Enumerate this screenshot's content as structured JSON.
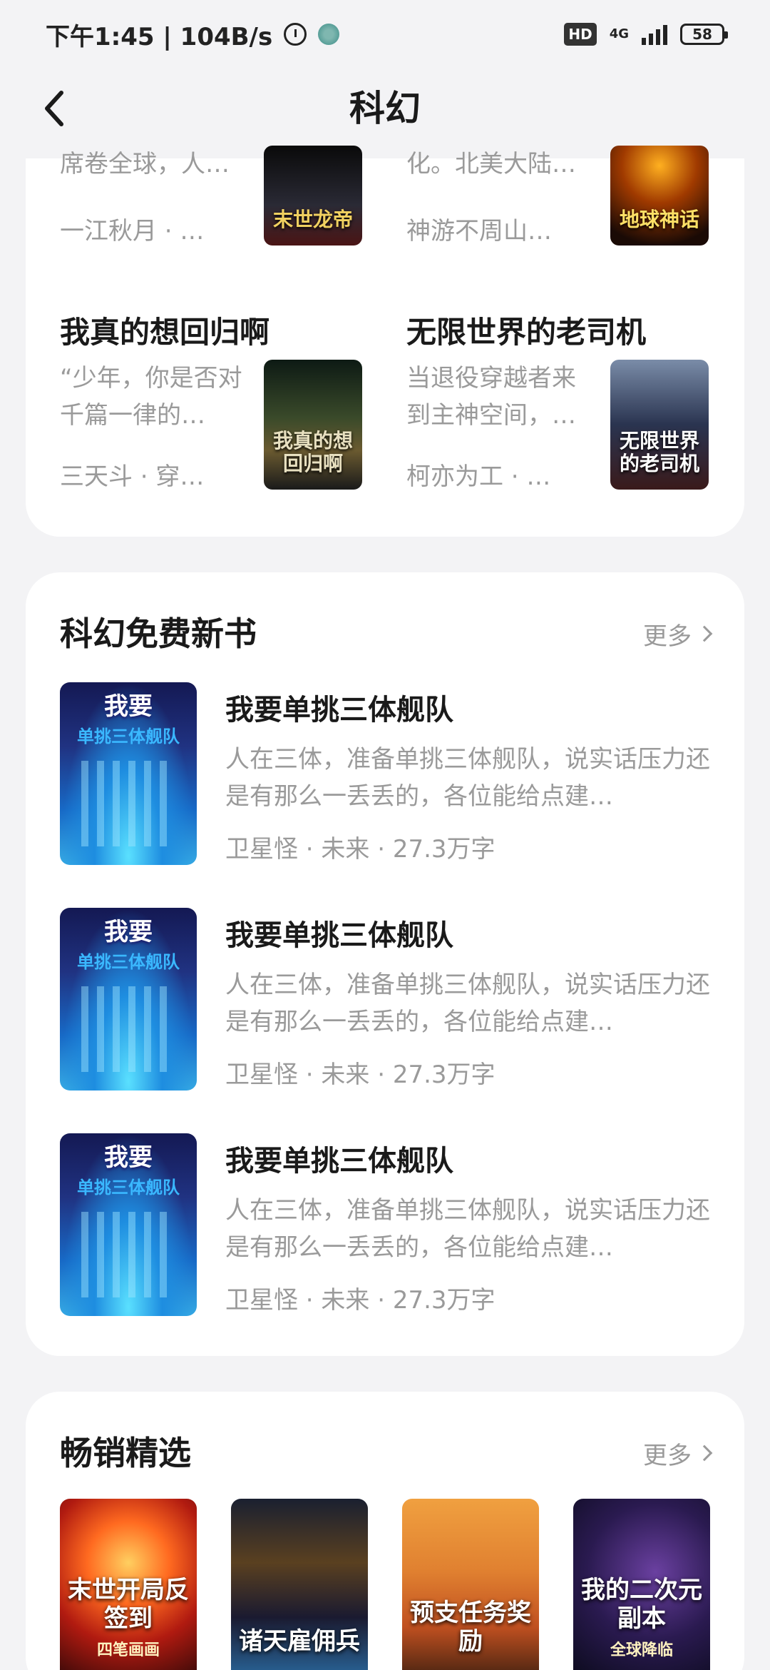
{
  "status_bar": {
    "time_speed": "下午1:45 | 104B/s",
    "hd": "HD",
    "network": "4G",
    "battery": "58"
  },
  "header": {
    "title": "科幻"
  },
  "grid": {
    "row1": [
      {
        "intro": "席卷全球，人…",
        "author": "一江秋月 · …",
        "cover_text": "末世龙帝"
      },
      {
        "intro": "化。北美大陆…",
        "author": "神游不周山…",
        "cover_text": "地球神话"
      }
    ],
    "row2": [
      {
        "title": "我真的想回归啊",
        "intro": "“少年，你是否对千篇一律的…",
        "author": "三天斗 · 穿…",
        "cover_text": "我真的想回归啊"
      },
      {
        "title": "无限世界的老司机",
        "intro": "当退役穿越者来到主神空间，…",
        "author": "柯亦为工 · …",
        "cover_text": "无限世界的老司机"
      }
    ]
  },
  "free_new": {
    "title": "科幻免费新书",
    "more": "更多",
    "books": [
      {
        "title": "我要单挑三体舰队",
        "intro": "人在三体，准备单挑三体舰队，说实话压力还是有那么一丢丢的，各位能给点建…",
        "meta": "卫星怪 · 未来 · 27.3万字",
        "cover_title": "我要",
        "cover_sub": "单挑三体舰队"
      },
      {
        "title": "我要单挑三体舰队",
        "intro": "人在三体，准备单挑三体舰队，说实话压力还是有那么一丢丢的，各位能给点建…",
        "meta": "卫星怪 · 未来 · 27.3万字",
        "cover_title": "我要",
        "cover_sub": "单挑三体舰队"
      },
      {
        "title": "我要单挑三体舰队",
        "intro": "人在三体，准备单挑三体舰队，说实话压力还是有那么一丢丢的，各位能给点建…",
        "meta": "卫星怪 · 未来 · 27.3万字",
        "cover_title": "我要",
        "cover_sub": "单挑三体舰队"
      }
    ]
  },
  "bestseller": {
    "title": "畅销精选",
    "more": "更多",
    "covers": [
      {
        "title": "末世开局反签到",
        "author": "四笔画画"
      },
      {
        "title": "诸天雇佣兵",
        "author": ""
      },
      {
        "title": "预支任务奖励",
        "author": ""
      },
      {
        "title": "我的二次元副本",
        "author": "全球降临"
      }
    ]
  }
}
